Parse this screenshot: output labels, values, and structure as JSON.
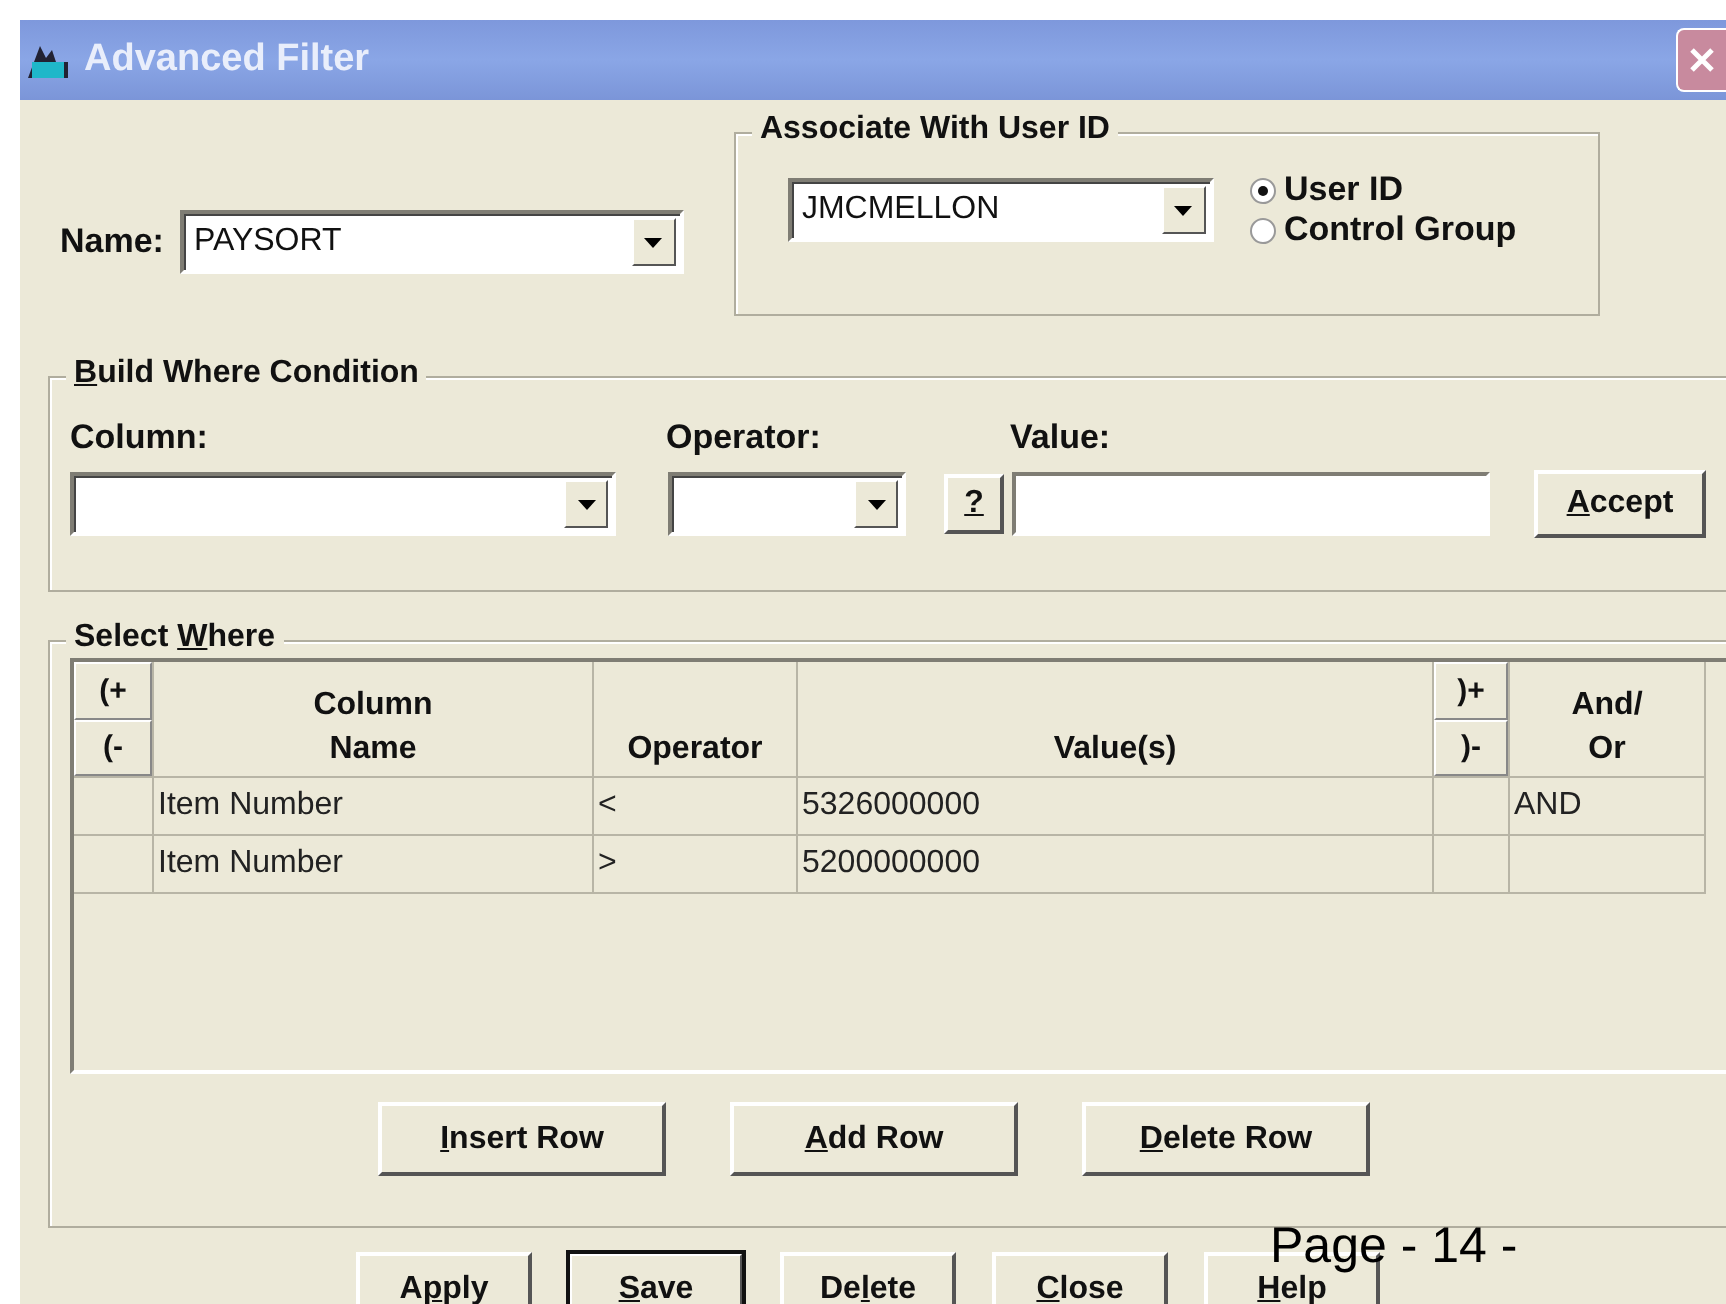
{
  "window": {
    "title": "Advanced Filter"
  },
  "name_field": {
    "label": "Name:",
    "value": "PAYSORT"
  },
  "associate": {
    "title": "Associate With User ID",
    "value": "JMCMELLON",
    "options": [
      {
        "label": "User ID",
        "selected": true
      },
      {
        "label": "Control Group",
        "selected": false
      }
    ]
  },
  "build_where": {
    "title": {
      "key": "B",
      "after": "uild Where Condition"
    },
    "column_label": "Column:",
    "operator_label": "Operator:",
    "value_label": "Value:",
    "help_button": {
      "key": "?"
    },
    "accept_button": {
      "key": "A",
      "after": "ccept"
    }
  },
  "select_where": {
    "title": {
      "before": "Select ",
      "key": "W",
      "after": "here"
    },
    "table": {
      "columns": [
        {
          "kind": "paren",
          "top": "(+",
          "bottom": "(-"
        },
        {
          "kind": "text",
          "lines": [
            "Column",
            "Name"
          ]
        },
        {
          "kind": "text",
          "lines": [
            "Operator"
          ]
        },
        {
          "kind": "text",
          "lines": [
            "Value(s)"
          ]
        },
        {
          "kind": "paren",
          "top": ")+",
          "bottom": ")-"
        },
        {
          "kind": "text",
          "lines": [
            "And/",
            "Or"
          ]
        }
      ],
      "rows": [
        [
          "",
          "Item Number",
          "<",
          "5326000000",
          "",
          "AND"
        ],
        [
          "",
          "Item Number",
          ">",
          "5200000000",
          "",
          ""
        ]
      ]
    },
    "buttons": [
      {
        "key": "I",
        "after": "nsert Row"
      },
      {
        "key": "A",
        "after": "dd Row"
      },
      {
        "key": "D",
        "after": "elete Row"
      }
    ]
  },
  "footer_buttons": [
    {
      "before": "A",
      "key": "p",
      "after": "ply",
      "default": false
    },
    {
      "key": "S",
      "after": "ave",
      "default": true
    },
    {
      "before": "De",
      "key": "l",
      "after": "ete",
      "default": false
    },
    {
      "key": "C",
      "after": "lose",
      "default": false
    },
    {
      "key": "H",
      "after": "elp",
      "default": false
    }
  ],
  "page_footer": "Page - 14 -"
}
